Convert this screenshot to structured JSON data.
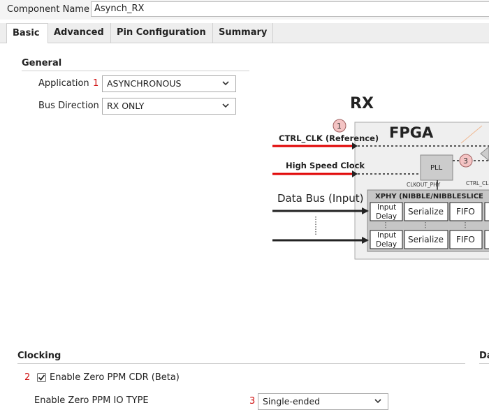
{
  "component": {
    "label": "Component Name",
    "value": "Asynch_RX"
  },
  "tabs": [
    {
      "label": "Basic",
      "active": true
    },
    {
      "label": "Advanced",
      "active": false
    },
    {
      "label": "Pin Configuration",
      "active": false
    },
    {
      "label": "Summary",
      "active": false
    }
  ],
  "general": {
    "title": "General",
    "application": {
      "label": "Application",
      "marker": "1",
      "value": "ASYNCHRONOUS"
    },
    "bus_direction": {
      "label": "Bus Direction",
      "value": "RX ONLY"
    }
  },
  "diagram": {
    "title": "RX",
    "fpga_label": "FPGA",
    "ctrl_clk_label": "CTRL_CLK (Reference)",
    "hs_clock_label": "High Speed Clock",
    "data_bus_label": "Data Bus (Input)",
    "pll_label": "PLL",
    "clkout_label": "CLKOUT_PHY",
    "ctrl_clk_internal": "CTRL_CL",
    "xphy_label": "XPHY (NIBBLE/NIBBLESLICE",
    "input_delay_label": "Input Delay",
    "serialize_label": "Serialize",
    "fifo_label": "FIFO",
    "marker_1": "1",
    "marker_3": "3"
  },
  "clocking": {
    "title": "Clocking",
    "cdr": {
      "marker": "2",
      "label": "Enable Zero PPM CDR (Beta)",
      "checked": true
    },
    "io_type": {
      "label": "Enable Zero PPM IO TYPE",
      "marker": "3",
      "value": "Single-ended"
    }
  },
  "right_section_label": "Da",
  "colors": {
    "marker_red": "#d01010",
    "arrow_red": "#e00000",
    "badge_fill": "#f4c4c4"
  }
}
